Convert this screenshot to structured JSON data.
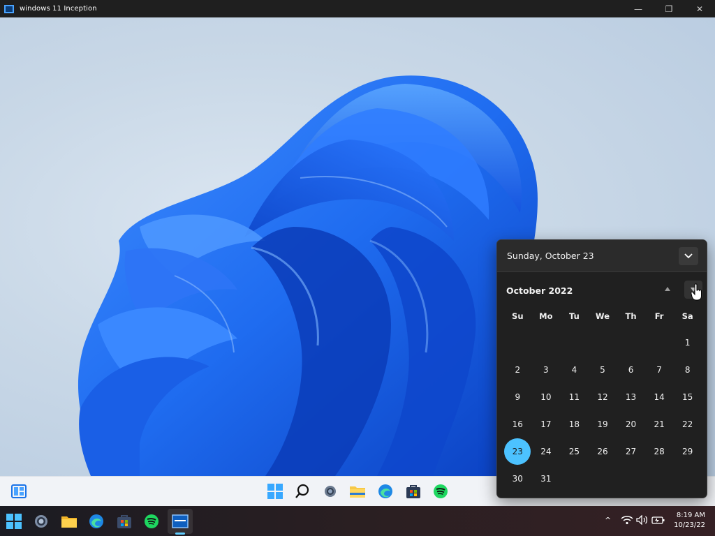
{
  "window": {
    "title": "windows 11 Inception",
    "controls": {
      "minimize": "—",
      "restore": "❐",
      "close": "✕"
    }
  },
  "calendar": {
    "date_header": "Sunday, October 23",
    "month_label": "October 2022",
    "weekdays": [
      "Su",
      "Mo",
      "Tu",
      "We",
      "Th",
      "Fr",
      "Sa"
    ],
    "weeks": [
      [
        "",
        "",
        "",
        "",
        "",
        "",
        "1"
      ],
      [
        "2",
        "3",
        "4",
        "5",
        "6",
        "7",
        "8"
      ],
      [
        "9",
        "10",
        "11",
        "12",
        "13",
        "14",
        "15"
      ],
      [
        "16",
        "17",
        "18",
        "19",
        "20",
        "21",
        "22"
      ],
      [
        "23",
        "24",
        "25",
        "26",
        "27",
        "28",
        "29"
      ],
      [
        "30",
        "31",
        "",
        "",
        "",
        "",
        ""
      ]
    ],
    "today": "23",
    "today_color": "#4cc2ff"
  },
  "inner_taskbar": {
    "icons": [
      "widgets-icon",
      "start-icon",
      "search-icon",
      "settings-icon",
      "file-explorer-icon",
      "edge-icon",
      "store-icon",
      "spotify-icon"
    ]
  },
  "host_taskbar": {
    "icons": [
      "start-icon",
      "settings-icon",
      "file-explorer-icon",
      "edge-icon",
      "store-icon",
      "spotify-icon",
      "remote-desktop-icon"
    ],
    "clock_time": "8:19 AM",
    "clock_date": "10/23/22",
    "tray_chevron": "^"
  },
  "colors": {
    "accent": "#60cdff",
    "flyout_bg": "#202020",
    "bloom_blue": "#1f6cf0"
  }
}
